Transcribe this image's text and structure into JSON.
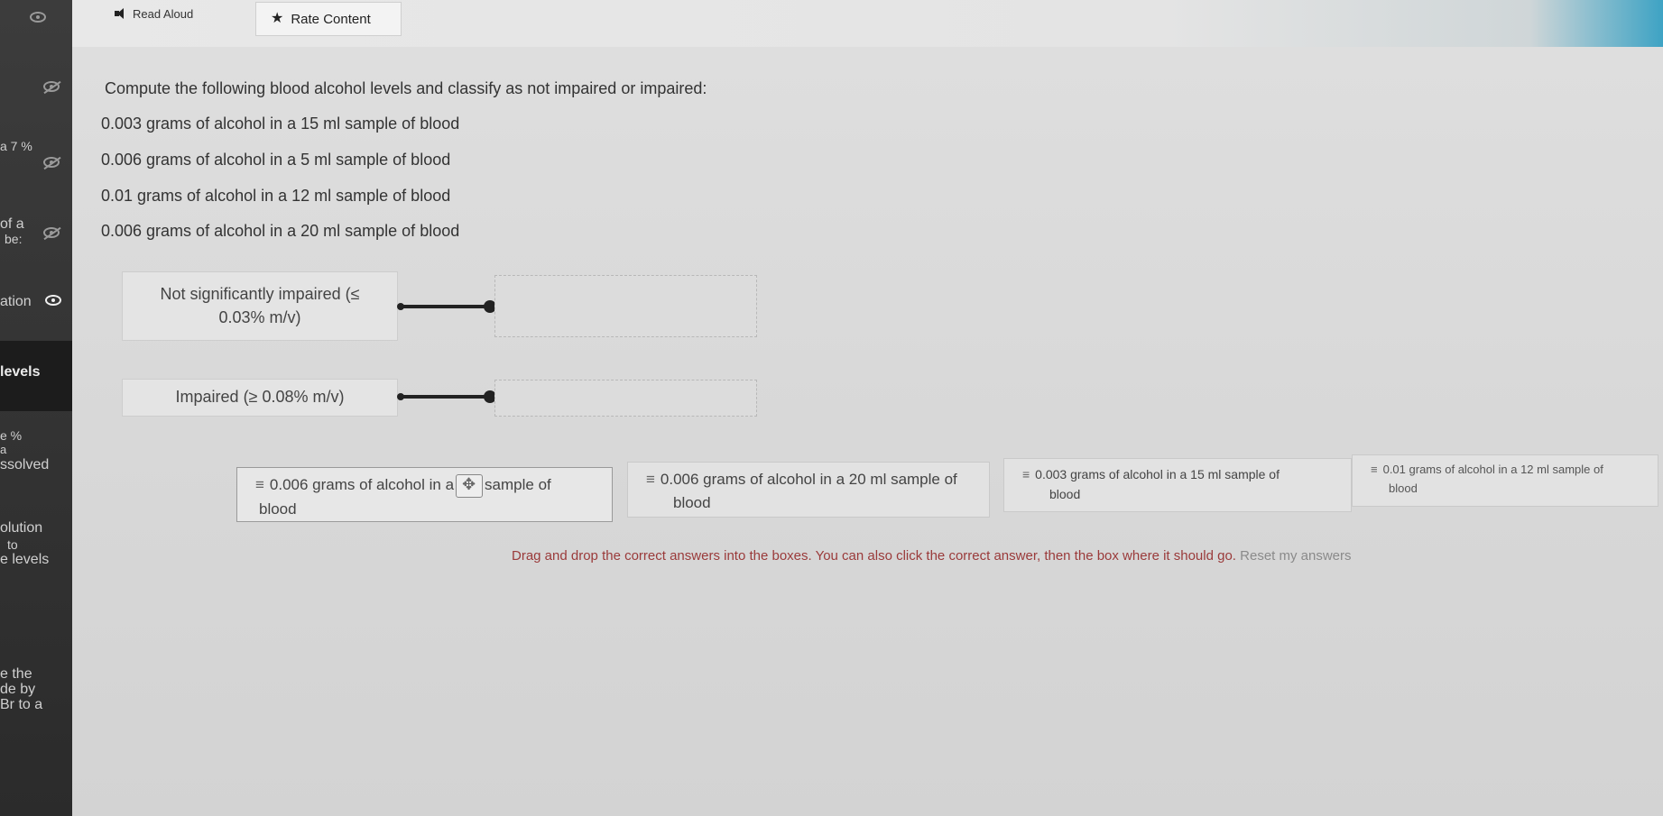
{
  "toolbar": {
    "read_aloud_label": "Read Aloud",
    "rate_content_label": "Rate Content"
  },
  "sidebar": {
    "fragments": [
      "a 7 %",
      "of a",
      "be:",
      "ation",
      "levels",
      "e %",
      "a",
      "ssolved",
      "olution",
      "to",
      "e levels",
      "e the",
      "de by",
      "Br to a"
    ]
  },
  "question": {
    "prompt": "Compute the following blood alcohol levels and classify as not impaired or impaired:",
    "items": [
      "0.003 grams of alcohol in a 15 ml sample of blood",
      "0.006 grams of alcohol in a 5 ml sample of blood",
      "0.01 grams of alcohol in a 12 ml sample of blood",
      "0.006 grams of alcohol in a 20 ml sample of blood"
    ]
  },
  "categories": [
    {
      "label_line1": "Not significantly impaired (≤",
      "label_line2": "0.03% m/v)"
    },
    {
      "label_line1": "Impaired (≥ 0.08% m/v)"
    }
  ],
  "answer_tiles": [
    {
      "handle": "≡",
      "text_a": "0.006 grams of alcohol in a",
      "text_b": "sample of",
      "text_c": "blood"
    },
    {
      "handle": "≡",
      "text_a": "0.006 grams of alcohol in a 20 ml sample of",
      "text_c": "blood"
    },
    {
      "handle": "≡",
      "text_a": "0.003 grams of alcohol in a 15 ml sample of",
      "text_c": "blood"
    },
    {
      "handle": "≡",
      "text_a": "0.01 grams of alcohol in a 12 ml sample of",
      "text_c": "blood"
    }
  ],
  "instructions": {
    "text": "Drag and drop the correct answers into the boxes. You can also click the correct answer, then the box where it should go.",
    "reset_label": "Reset my answers"
  },
  "colors": {
    "accent_corner": "#3ea3c4",
    "instruction_text": "#9a3a3a",
    "sidebar_bg": "#2b2b2b"
  }
}
